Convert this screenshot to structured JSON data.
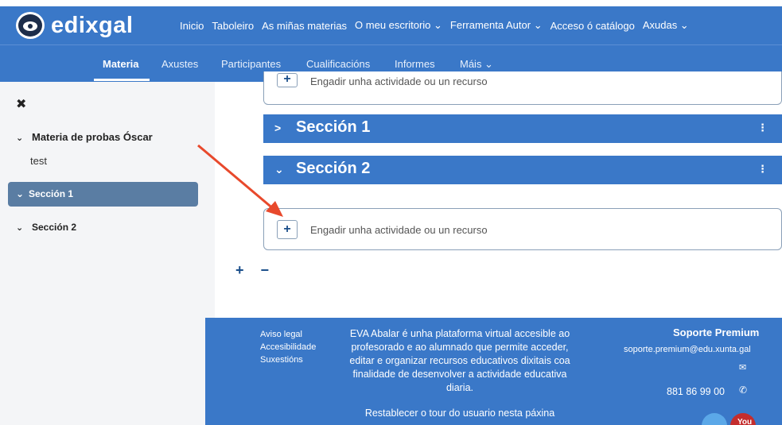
{
  "brand": {
    "name": "edixgal"
  },
  "topnav": [
    "Inicio",
    "Taboleiro",
    "As miñas materias",
    "O meu escritorio ⌄",
    "Ferramenta Autor ⌄",
    "Acceso ó catálogo",
    "Axudas ⌄"
  ],
  "subnav": {
    "materia": "Materia",
    "axustes": "Axustes",
    "participantes": "Participantes",
    "cualificacions": "Cualificacións",
    "informes": "Informes",
    "mais": "Máis ⌄"
  },
  "sidebar": {
    "close_glyph": "✖",
    "course": "Materia de probas Óscar",
    "topic": "test",
    "section1": "Sección 1",
    "section2": "Sección 2",
    "chevron": "⌄"
  },
  "main": {
    "add_activity": "Engadir unha actividade ou un recurso",
    "add_activity_cut": "Engadir unha actividade ou un recurso",
    "section1_title": "Sección 1",
    "section2_title": "Sección 2",
    "section1_chevron": ">",
    "section2_chevron": "⌄",
    "kebab": "⋮",
    "plus": "+",
    "controls": "+ −"
  },
  "footer": {
    "links": [
      "Aviso legal",
      "Accesibilidade",
      "Suxestións"
    ],
    "description": "EVA Abalar é unha plataforma virtual accesible ao profesorado e ao alumnado que permite acceder, editar e organizar recursos educativos dixitais coa finalidade de desenvolver a actividade educativa diaria.",
    "tour": "Restablecer o tour do usuario nesta páxina",
    "support_title": "Soporte Premium",
    "support_email": "soporte.premium@edu.xunta.gal",
    "phone": "881 86 99 00",
    "mail_glyph": "✉",
    "phone_glyph": "✆",
    "youtube_label": "You"
  },
  "colors": {
    "primary": "#3a78c8",
    "active_section": "#5a7da3",
    "sidebar_bg": "#f4f5f7"
  }
}
